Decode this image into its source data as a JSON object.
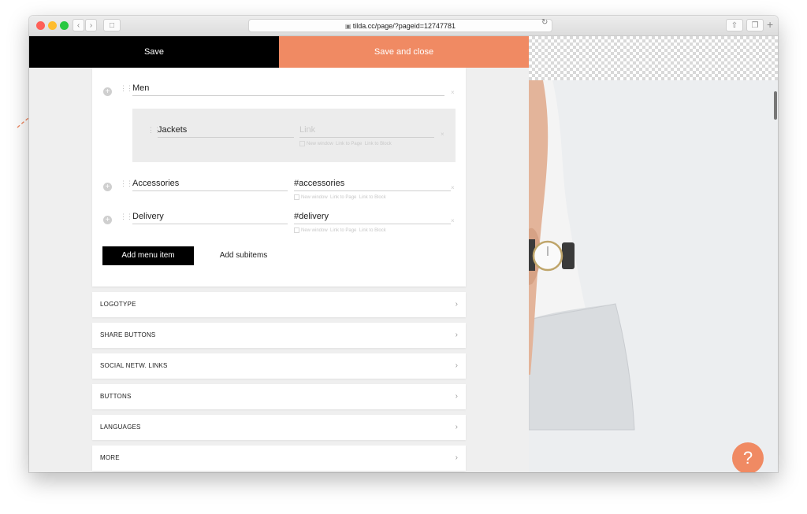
{
  "browser": {
    "url": "tilda.cc/page/?pageid=12747781",
    "lock_icon": "lock-icon"
  },
  "savebar": {
    "save_label": "Save",
    "save_close_label": "Save and close"
  },
  "menu": {
    "items": [
      {
        "title": "Men",
        "link": ""
      },
      {
        "title": "Accessories",
        "link": "#accessories"
      },
      {
        "title": "Delivery",
        "link": "#delivery"
      }
    ],
    "subitem": {
      "title": "Jackets",
      "link_placeholder": "Link"
    },
    "link_options": {
      "new_window": "New window",
      "link_to_page": "Link to Page",
      "link_to_block": "Link to Block"
    },
    "add_menu_item": "Add menu item",
    "add_subitems": "Add subitems"
  },
  "sections": [
    "LOGOTYPE",
    "SHARE BUTTONS",
    "SOCIAL NETW. LINKS",
    "BUTTONS",
    "LANGUAGES",
    "MORE"
  ],
  "help_label": "?",
  "colors": {
    "accent": "#f08a63",
    "dark": "#000000"
  }
}
